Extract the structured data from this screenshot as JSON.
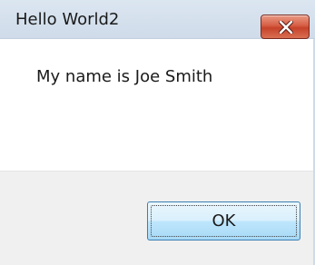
{
  "window": {
    "title": "Hello World2",
    "message": "My name is Joe Smith",
    "ok_label": "OK",
    "close_icon": "close-x-icon"
  },
  "colors": {
    "titlebar": "#d4e0ed",
    "close_button": "#d05a40",
    "footer": "#f0f0f0",
    "ok_button_border": "#3c7fb1"
  }
}
